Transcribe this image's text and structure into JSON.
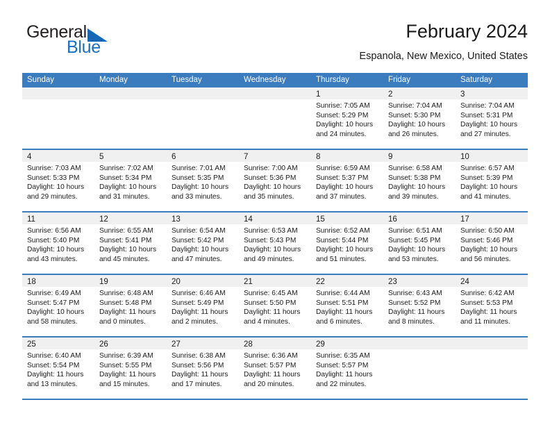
{
  "brand": {
    "name_part1": "General",
    "name_part2": "Blue",
    "logo_icon": "triangle-logo-icon"
  },
  "header": {
    "month_title": "February 2024",
    "location": "Espanola, New Mexico, United States"
  },
  "calendar": {
    "weekdays": [
      "Sunday",
      "Monday",
      "Tuesday",
      "Wednesday",
      "Thursday",
      "Friday",
      "Saturday"
    ],
    "accent_color": "#3b7cbe",
    "daynum_band_color": "#f0f0f0",
    "weeks": [
      [
        {
          "day": "",
          "sunrise": "",
          "sunset": "",
          "daylight": "",
          "empty": true
        },
        {
          "day": "",
          "sunrise": "",
          "sunset": "",
          "daylight": "",
          "empty": true
        },
        {
          "day": "",
          "sunrise": "",
          "sunset": "",
          "daylight": "",
          "empty": true
        },
        {
          "day": "",
          "sunrise": "",
          "sunset": "",
          "daylight": "",
          "empty": true
        },
        {
          "day": "1",
          "sunrise": "Sunrise: 7:05 AM",
          "sunset": "Sunset: 5:29 PM",
          "daylight": "Daylight: 10 hours and 24 minutes.",
          "empty": false
        },
        {
          "day": "2",
          "sunrise": "Sunrise: 7:04 AM",
          "sunset": "Sunset: 5:30 PM",
          "daylight": "Daylight: 10 hours and 26 minutes.",
          "empty": false
        },
        {
          "day": "3",
          "sunrise": "Sunrise: 7:04 AM",
          "sunset": "Sunset: 5:31 PM",
          "daylight": "Daylight: 10 hours and 27 minutes.",
          "empty": false
        }
      ],
      [
        {
          "day": "4",
          "sunrise": "Sunrise: 7:03 AM",
          "sunset": "Sunset: 5:33 PM",
          "daylight": "Daylight: 10 hours and 29 minutes.",
          "empty": false
        },
        {
          "day": "5",
          "sunrise": "Sunrise: 7:02 AM",
          "sunset": "Sunset: 5:34 PM",
          "daylight": "Daylight: 10 hours and 31 minutes.",
          "empty": false
        },
        {
          "day": "6",
          "sunrise": "Sunrise: 7:01 AM",
          "sunset": "Sunset: 5:35 PM",
          "daylight": "Daylight: 10 hours and 33 minutes.",
          "empty": false
        },
        {
          "day": "7",
          "sunrise": "Sunrise: 7:00 AM",
          "sunset": "Sunset: 5:36 PM",
          "daylight": "Daylight: 10 hours and 35 minutes.",
          "empty": false
        },
        {
          "day": "8",
          "sunrise": "Sunrise: 6:59 AM",
          "sunset": "Sunset: 5:37 PM",
          "daylight": "Daylight: 10 hours and 37 minutes.",
          "empty": false
        },
        {
          "day": "9",
          "sunrise": "Sunrise: 6:58 AM",
          "sunset": "Sunset: 5:38 PM",
          "daylight": "Daylight: 10 hours and 39 minutes.",
          "empty": false
        },
        {
          "day": "10",
          "sunrise": "Sunrise: 6:57 AM",
          "sunset": "Sunset: 5:39 PM",
          "daylight": "Daylight: 10 hours and 41 minutes.",
          "empty": false
        }
      ],
      [
        {
          "day": "11",
          "sunrise": "Sunrise: 6:56 AM",
          "sunset": "Sunset: 5:40 PM",
          "daylight": "Daylight: 10 hours and 43 minutes.",
          "empty": false
        },
        {
          "day": "12",
          "sunrise": "Sunrise: 6:55 AM",
          "sunset": "Sunset: 5:41 PM",
          "daylight": "Daylight: 10 hours and 45 minutes.",
          "empty": false
        },
        {
          "day": "13",
          "sunrise": "Sunrise: 6:54 AM",
          "sunset": "Sunset: 5:42 PM",
          "daylight": "Daylight: 10 hours and 47 minutes.",
          "empty": false
        },
        {
          "day": "14",
          "sunrise": "Sunrise: 6:53 AM",
          "sunset": "Sunset: 5:43 PM",
          "daylight": "Daylight: 10 hours and 49 minutes.",
          "empty": false
        },
        {
          "day": "15",
          "sunrise": "Sunrise: 6:52 AM",
          "sunset": "Sunset: 5:44 PM",
          "daylight": "Daylight: 10 hours and 51 minutes.",
          "empty": false
        },
        {
          "day": "16",
          "sunrise": "Sunrise: 6:51 AM",
          "sunset": "Sunset: 5:45 PM",
          "daylight": "Daylight: 10 hours and 53 minutes.",
          "empty": false
        },
        {
          "day": "17",
          "sunrise": "Sunrise: 6:50 AM",
          "sunset": "Sunset: 5:46 PM",
          "daylight": "Daylight: 10 hours and 56 minutes.",
          "empty": false
        }
      ],
      [
        {
          "day": "18",
          "sunrise": "Sunrise: 6:49 AM",
          "sunset": "Sunset: 5:47 PM",
          "daylight": "Daylight: 10 hours and 58 minutes.",
          "empty": false
        },
        {
          "day": "19",
          "sunrise": "Sunrise: 6:48 AM",
          "sunset": "Sunset: 5:48 PM",
          "daylight": "Daylight: 11 hours and 0 minutes.",
          "empty": false
        },
        {
          "day": "20",
          "sunrise": "Sunrise: 6:46 AM",
          "sunset": "Sunset: 5:49 PM",
          "daylight": "Daylight: 11 hours and 2 minutes.",
          "empty": false
        },
        {
          "day": "21",
          "sunrise": "Sunrise: 6:45 AM",
          "sunset": "Sunset: 5:50 PM",
          "daylight": "Daylight: 11 hours and 4 minutes.",
          "empty": false
        },
        {
          "day": "22",
          "sunrise": "Sunrise: 6:44 AM",
          "sunset": "Sunset: 5:51 PM",
          "daylight": "Daylight: 11 hours and 6 minutes.",
          "empty": false
        },
        {
          "day": "23",
          "sunrise": "Sunrise: 6:43 AM",
          "sunset": "Sunset: 5:52 PM",
          "daylight": "Daylight: 11 hours and 8 minutes.",
          "empty": false
        },
        {
          "day": "24",
          "sunrise": "Sunrise: 6:42 AM",
          "sunset": "Sunset: 5:53 PM",
          "daylight": "Daylight: 11 hours and 11 minutes.",
          "empty": false
        }
      ],
      [
        {
          "day": "25",
          "sunrise": "Sunrise: 6:40 AM",
          "sunset": "Sunset: 5:54 PM",
          "daylight": "Daylight: 11 hours and 13 minutes.",
          "empty": false
        },
        {
          "day": "26",
          "sunrise": "Sunrise: 6:39 AM",
          "sunset": "Sunset: 5:55 PM",
          "daylight": "Daylight: 11 hours and 15 minutes.",
          "empty": false
        },
        {
          "day": "27",
          "sunrise": "Sunrise: 6:38 AM",
          "sunset": "Sunset: 5:56 PM",
          "daylight": "Daylight: 11 hours and 17 minutes.",
          "empty": false
        },
        {
          "day": "28",
          "sunrise": "Sunrise: 6:36 AM",
          "sunset": "Sunset: 5:57 PM",
          "daylight": "Daylight: 11 hours and 20 minutes.",
          "empty": false
        },
        {
          "day": "29",
          "sunrise": "Sunrise: 6:35 AM",
          "sunset": "Sunset: 5:57 PM",
          "daylight": "Daylight: 11 hours and 22 minutes.",
          "empty": false
        },
        {
          "day": "",
          "sunrise": "",
          "sunset": "",
          "daylight": "",
          "empty": true
        },
        {
          "day": "",
          "sunrise": "",
          "sunset": "",
          "daylight": "",
          "empty": true
        }
      ]
    ]
  }
}
